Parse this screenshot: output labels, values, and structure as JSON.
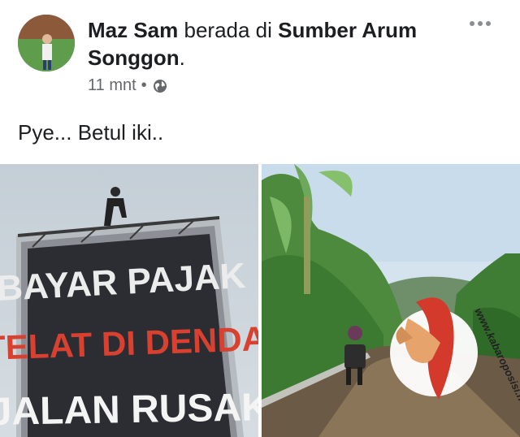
{
  "post": {
    "author": "Maz Sam",
    "connector": " berada di ",
    "location": "Sumber Arum Songgon",
    "location_end": ".",
    "time": "11 mnt",
    "dot": "•",
    "text": "Pye... Betul iki.."
  },
  "left_photo": {
    "sign_line1": "BAYAR PAJAK",
    "sign_line2": "TELAT DI DENDA",
    "sign_line3": "JALAN RUSAK"
  },
  "right_photo": {
    "watermark": "www.kabaroposisi.net"
  },
  "colors": {
    "text": "#1c1e21",
    "meta": "#65676b",
    "sign_red": "#d8402f",
    "sign_white": "#f4f4f4"
  },
  "icons": [
    "more-options-icon",
    "globe-icon",
    "raised-fist-logo"
  ]
}
